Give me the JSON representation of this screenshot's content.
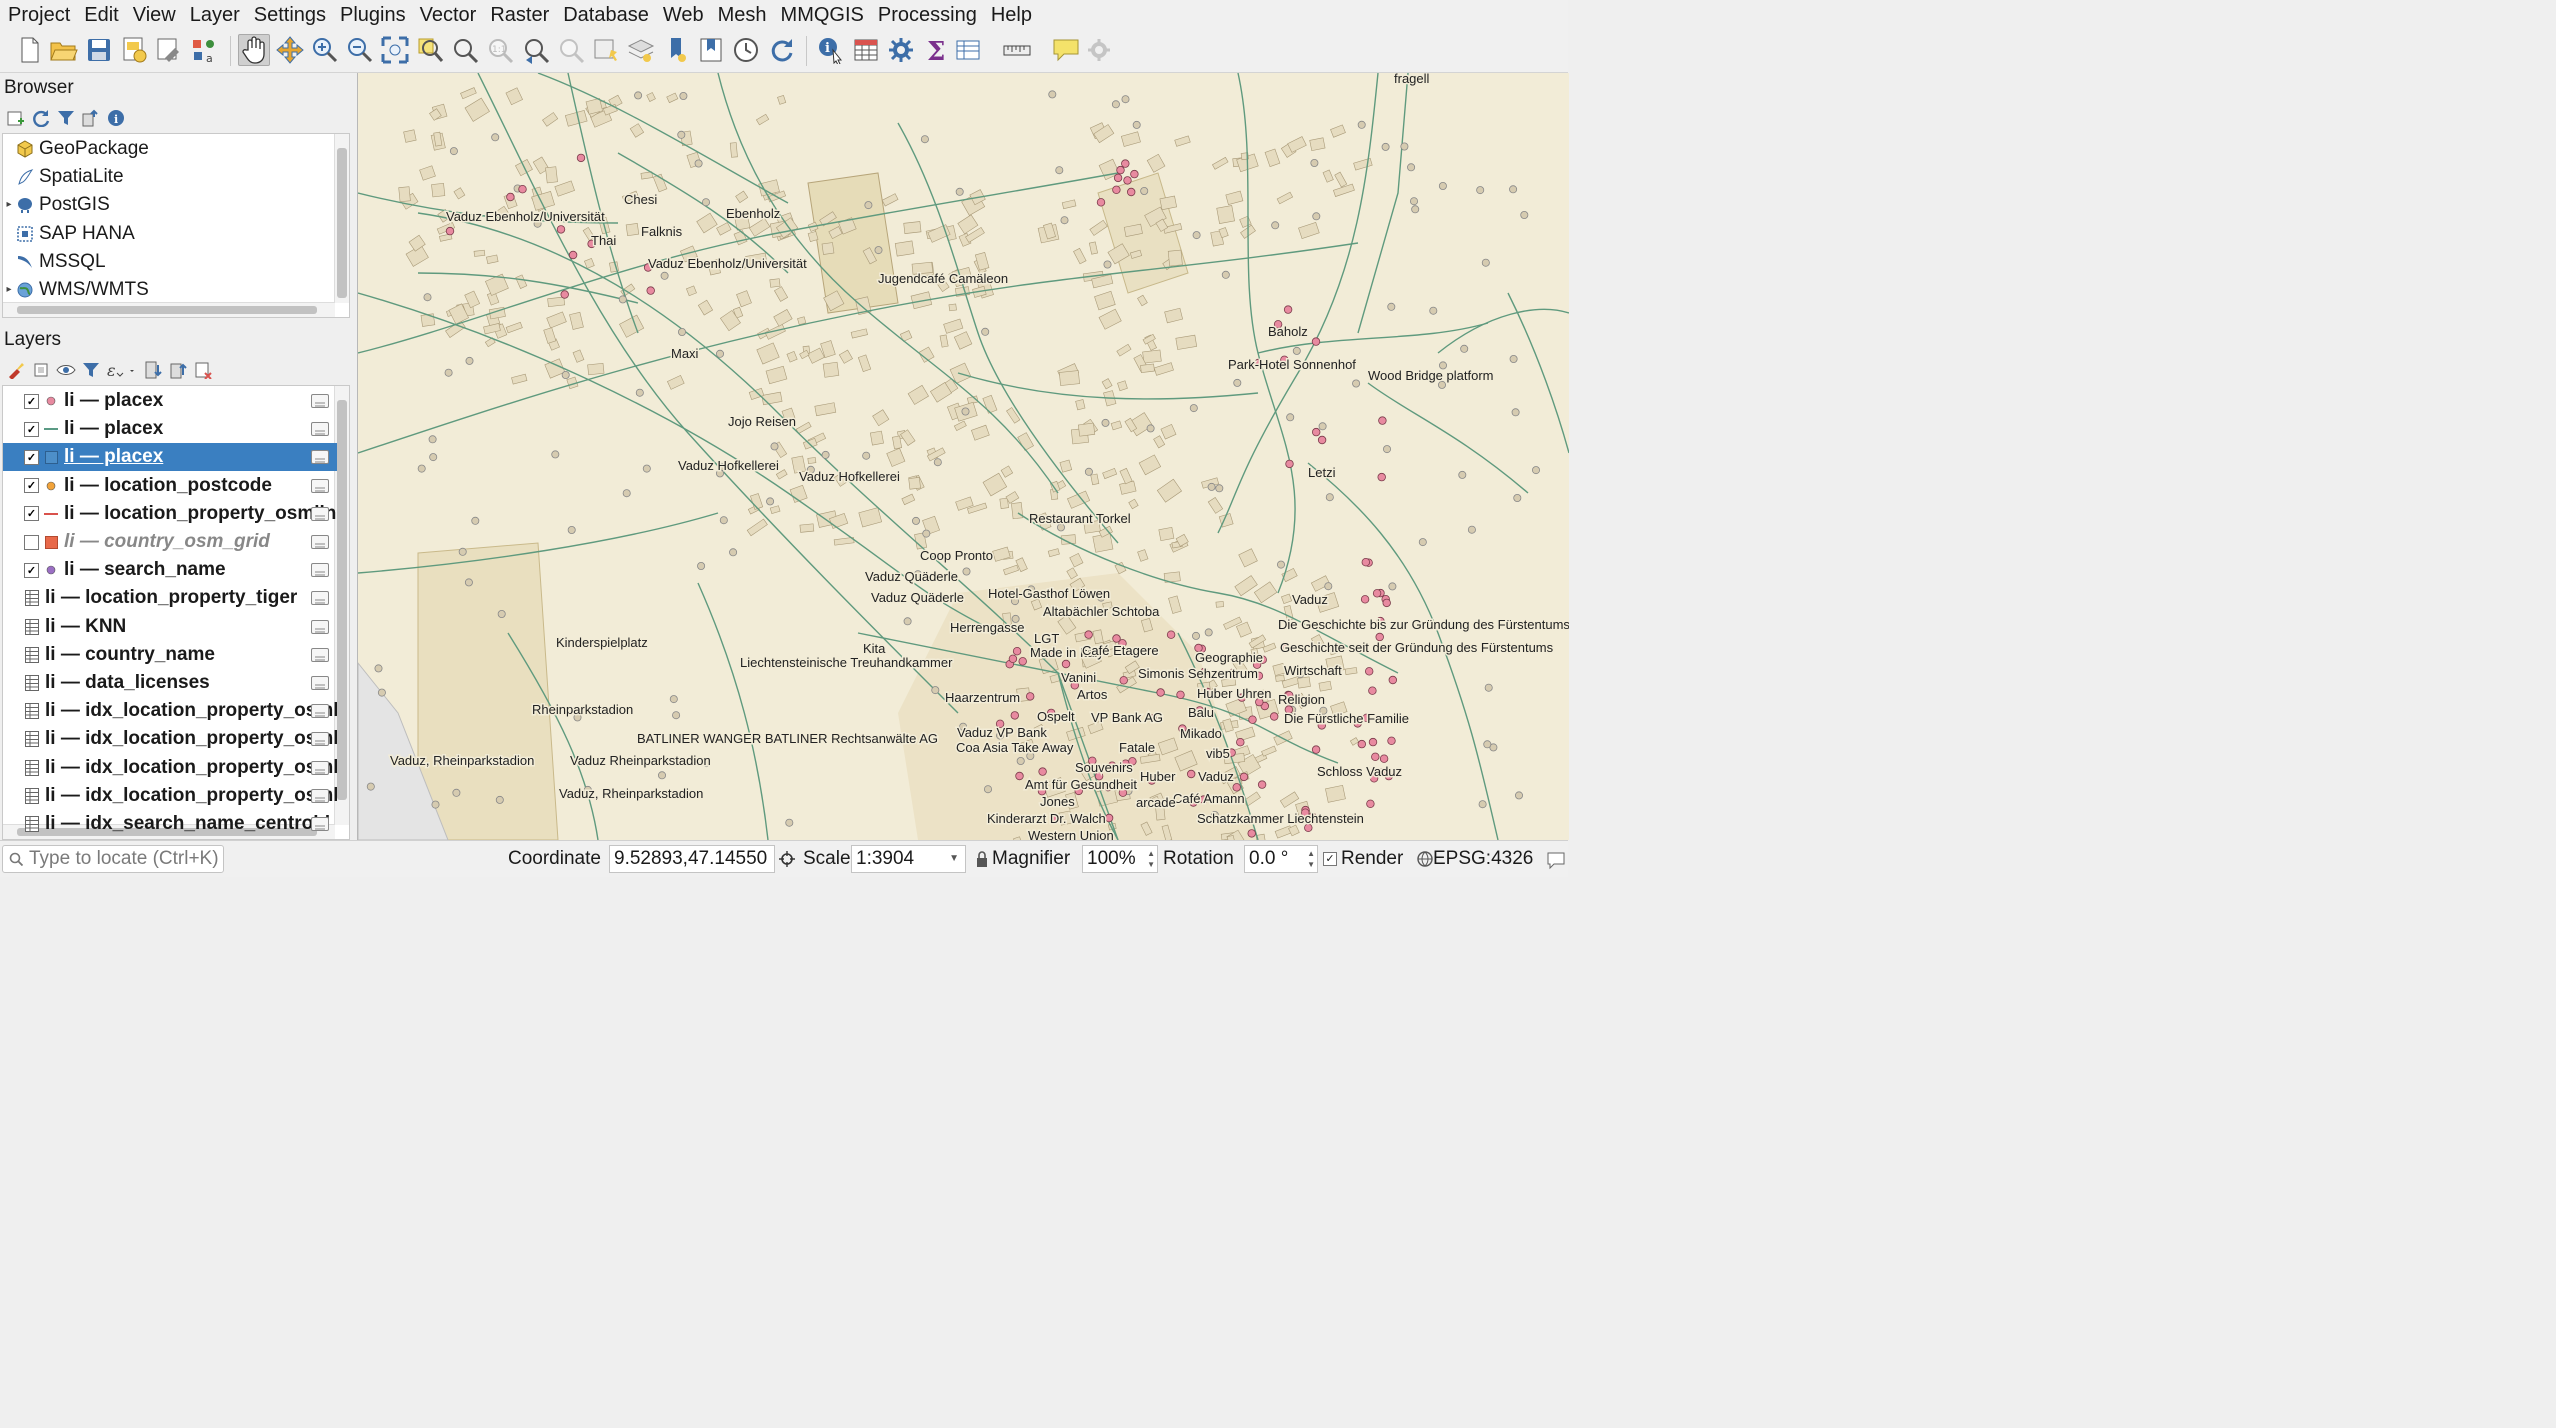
{
  "menu": [
    "Project",
    "Edit",
    "View",
    "Layer",
    "Settings",
    "Plugins",
    "Vector",
    "Raster",
    "Database",
    "Web",
    "Mesh",
    "MMQGIS",
    "Processing",
    "Help"
  ],
  "browser": {
    "title": "Browser",
    "items": [
      {
        "label": "GeoPackage",
        "icon": "geopackage-icon",
        "expandable": false
      },
      {
        "label": "SpatiaLite",
        "icon": "spatialite-icon",
        "expandable": false
      },
      {
        "label": "PostGIS",
        "icon": "postgis-icon",
        "expandable": true
      },
      {
        "label": "SAP HANA",
        "icon": "sap-hana-icon",
        "expandable": false
      },
      {
        "label": "MSSQL",
        "icon": "mssql-icon",
        "expandable": false
      },
      {
        "label": "WMS/WMTS",
        "icon": "wms-icon",
        "expandable": true
      }
    ]
  },
  "layers": {
    "title": "Layers",
    "items": [
      {
        "label": "li — placex",
        "checked": true,
        "symbol": "point",
        "color": "#e88aa0",
        "selected": false,
        "disabled": false
      },
      {
        "label": "li — placex",
        "checked": true,
        "symbol": "line",
        "color": "#5a9a84",
        "selected": false,
        "disabled": false
      },
      {
        "label": "li — placex",
        "checked": true,
        "symbol": "polygon",
        "color": "#4d8fc9",
        "selected": true,
        "disabled": false
      },
      {
        "label": "li — location_postcode",
        "checked": true,
        "symbol": "point",
        "color": "#f2a33a",
        "selected": false,
        "disabled": false
      },
      {
        "label": "li — location_property_osmline",
        "checked": true,
        "symbol": "line",
        "color": "#d9524c",
        "selected": false,
        "disabled": false
      },
      {
        "label": "li — country_osm_grid",
        "checked": false,
        "symbol": "square",
        "color": "#e8694a",
        "selected": false,
        "disabled": true
      },
      {
        "label": "li — search_name",
        "checked": true,
        "symbol": "point",
        "color": "#9b6fc4",
        "selected": false,
        "disabled": false
      },
      {
        "label": "li — location_property_tiger",
        "checked": null,
        "symbol": "table",
        "color": "",
        "selected": false,
        "disabled": false
      },
      {
        "label": "li — KNN",
        "checked": null,
        "symbol": "table",
        "color": "",
        "selected": false,
        "disabled": false
      },
      {
        "label": "li — country_name",
        "checked": null,
        "symbol": "table",
        "color": "",
        "selected": false,
        "disabled": false
      },
      {
        "label": "li — data_licenses",
        "checked": null,
        "symbol": "table",
        "color": "",
        "selected": false,
        "disabled": false
      },
      {
        "label": "li — idx_location_property_osmline",
        "checked": null,
        "symbol": "table",
        "color": "",
        "selected": false,
        "disabled": false
      },
      {
        "label": "li — idx_location_property_osmline",
        "checked": null,
        "symbol": "table",
        "color": "",
        "selected": false,
        "disabled": false
      },
      {
        "label": "li — idx_location_property_osmline",
        "checked": null,
        "symbol": "table",
        "color": "",
        "selected": false,
        "disabled": false
      },
      {
        "label": "li — idx_location_property_osmline",
        "checked": null,
        "symbol": "table",
        "color": "",
        "selected": false,
        "disabled": false
      },
      {
        "label": "li — idx_search_name_centroid",
        "checked": null,
        "symbol": "table",
        "color": "",
        "selected": false,
        "disabled": false
      }
    ]
  },
  "map_labels": [
    "Vaduz Ebenholz/Universität",
    "Chesi",
    "Ebenholz",
    "Falknis",
    "Thai",
    "Vaduz Ebenholz/Universität",
    "Jugendcafé Camäleon",
    "Maxi",
    "Jojo Reisen",
    "Vaduz Hofkellerei",
    "Vaduz Hofkellerei",
    "Restaurant Torkel",
    "Coop Pronto",
    "Vaduz Quäderle",
    "Vaduz Quäderle",
    "Hotel-Gasthof Löwen",
    "Altabächler Schtoba",
    "Herrengasse",
    "LGT",
    "Made in Italy",
    "Café Etagere",
    "Kita",
    "Liechtensteinische Treuhandkammer",
    "Kinderspielplatz",
    "Rheinparkstadion",
    "BATLINER WANGER BATLINER Rechtsanwälte AG",
    "Vaduz, Rheinparkstadion",
    "Vaduz Rheinparkstadion",
    "Vaduz, Rheinparkstadion",
    "Haarzentrum",
    "Vanini",
    "Artos",
    "Simonis Sehzentrum",
    "Geographie",
    "Ospelt",
    "VP Bank AG",
    "Huber Uhren",
    "Balu",
    "Vaduz VP Bank",
    "Coa Asia Take Away",
    "Fatale",
    "Mikado",
    "vib5",
    "Souvenirs",
    "Huber",
    "Vaduz",
    "Amt für Gesundheit",
    "Café Amann",
    "Jones",
    "arcade",
    "Kinderarzt Dr. Walch",
    "Schatzkammer Liechtenstein",
    "Western Union",
    "Baholz",
    "Park-Hotel Sonnenhof",
    "Wood Bridge platform",
    "Letzi",
    "Vaduz",
    "Die Geschichte bis zur Gründung des Fürstentums",
    "Geschichte seit der Gründung des Fürstentums",
    "Wirtschaft",
    "Religion",
    "Die Fürstliche Familie",
    "Schloss Vaduz",
    "fragell"
  ],
  "status": {
    "locate_placeholder": "Type to locate (Ctrl+K)",
    "coordinate_label": "Coordinate",
    "coordinate_value": "9.52893,47.14550",
    "scale_label": "Scale",
    "scale_value": "1:3904",
    "magnifier_label": "Magnifier",
    "magnifier_value": "100%",
    "rotation_label": "Rotation",
    "rotation_value": "0.0 °",
    "render_label": "Render",
    "crs_label": "EPSG:4326"
  },
  "colors": {
    "map_background": "#f2ecd7",
    "road": "#5f9a7e",
    "building": "#e6dcc0",
    "poi": "#e88aa0",
    "selection": "#3a7fc1"
  }
}
